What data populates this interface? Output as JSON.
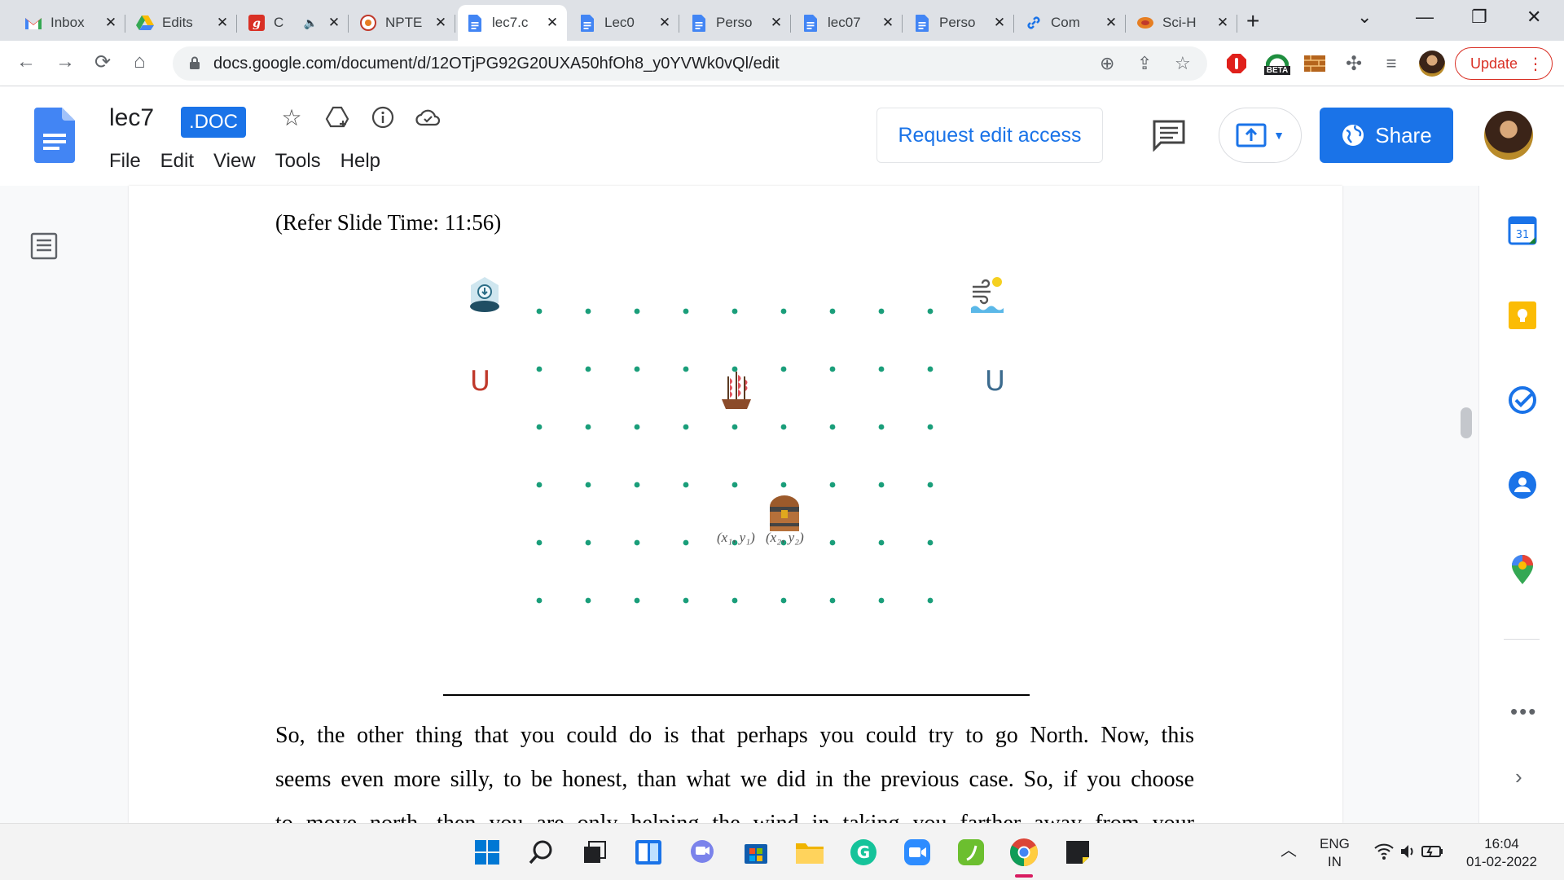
{
  "browser": {
    "tabs": [
      {
        "title": "Inbox",
        "icon": "gmail-icon"
      },
      {
        "title": "Edits",
        "icon": "google-drive-icon"
      },
      {
        "title": "C",
        "icon": "g-app-icon",
        "audio": "🔈"
      },
      {
        "title": "NPTE",
        "icon": "nptel-icon"
      },
      {
        "title": "lec7.c",
        "icon": "google-docs-icon",
        "active": true
      },
      {
        "title": "Lec0",
        "icon": "google-docs-icon"
      },
      {
        "title": "Perso",
        "icon": "google-docs-icon"
      },
      {
        "title": "lec07",
        "icon": "google-docs-icon"
      },
      {
        "title": "Perso",
        "icon": "google-docs-icon"
      },
      {
        "title": "Com",
        "icon": "link-icon"
      },
      {
        "title": "Sci-H",
        "icon": "scihub-icon"
      }
    ],
    "tab_close": "✕",
    "new_tab": "+",
    "url": "docs.google.com/document/d/12OTjPG92G20UXA50hfOh8_y0YVWk0vQl/edit",
    "update_label": "Update",
    "beta_label": "BETA"
  },
  "docs": {
    "title": "lec7",
    "badge": ".DOC",
    "menu": [
      "File",
      "Edit",
      "View",
      "Tools",
      "Help"
    ],
    "request_edit": "Request edit access",
    "share": "Share"
  },
  "document": {
    "slide_caption": "(Refer Slide Time: 11:56)",
    "slide": {
      "left_glyph": "U",
      "right_glyph": "U",
      "coord_1": "(x₁, y₁)",
      "coord_2": "(x₂, y₂)",
      "grid_rows": 6,
      "grid_cols": 9,
      "dot_color": "#1a9e7a"
    },
    "paragraph_lines": [
      "So, the other thing that you could do is that perhaps you could try to go North. Now, this",
      "seems even more silly, to be honest, than what we did in the previous case. So, if you choose",
      "to move north, then you are only helping the wind in taking you farther away from your"
    ]
  },
  "taskbar": {
    "lang_top": "ENG",
    "lang_bottom": "IN",
    "time": "16:04",
    "date": "01-02-2022"
  },
  "colors": {
    "accent": "#1a73e8",
    "update_red": "#d93025",
    "tabstrip": "#dee1e6"
  }
}
